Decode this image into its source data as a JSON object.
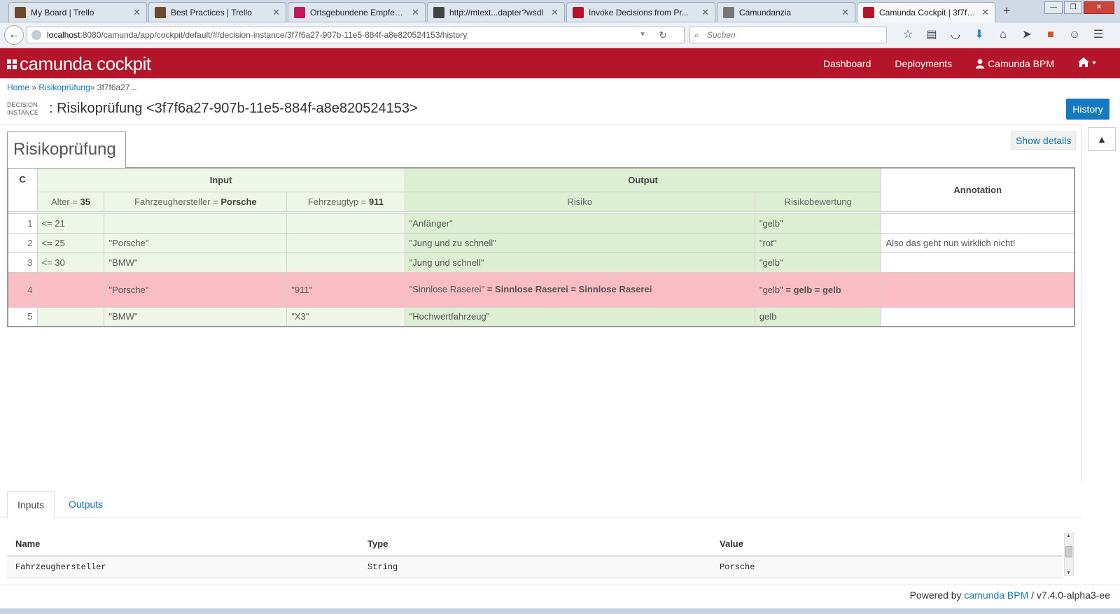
{
  "browser": {
    "tabs": [
      {
        "title": "My Board | Trello",
        "color": "#6b4a2e"
      },
      {
        "title": "Best Practices | Trello",
        "color": "#6b4a2e"
      },
      {
        "title": "Ortsgebundene Empfehl...",
        "color": "#c2185b"
      },
      {
        "title": "http://mtext...dapter?wsdl",
        "color": "#444444"
      },
      {
        "title": "Invoke Decisions from Pr...",
        "color": "#b5152b"
      },
      {
        "title": "Camundanzia",
        "color": "#777777"
      },
      {
        "title": "Camunda Cockpit | 3f7f6...",
        "color": "#b5152b"
      }
    ],
    "url_host": "localhost",
    "url_rest": ":8080/camunda/app/cockpit/default/#/decision-instance/3f7f6a27-907b-11e5-884f-a8e820524153/history",
    "search_placeholder": "Suchen"
  },
  "app": {
    "brand": "camunda cockpit",
    "menu": [
      "Dashboard",
      "Deployments"
    ],
    "user": "Camunda BPM"
  },
  "breadcrumb": {
    "home": "Home",
    "sep1": "»",
    "decision": "Risikoprüfung",
    "sep2": "»",
    "current": "3f7f6a27..."
  },
  "instance": {
    "label_line1": "DECISION",
    "label_line2": "INSTANCE",
    "title": ": Risikoprüfung <3f7f6a27-907b-11e5-884f-a8e820524153>",
    "history_button": "History"
  },
  "decision": {
    "name": "Risikoprüfung",
    "show_details": "Show details",
    "hit_policy": "C",
    "input_group": "Input",
    "output_group": "Output",
    "annotation_header": "Annotation",
    "inputs": [
      {
        "label": "Alter",
        "eq": " = ",
        "value": "35"
      },
      {
        "label": "Fahrzeughersteller",
        "eq": " = ",
        "value": "Porsche"
      },
      {
        "label": "Fehrzeugtyp",
        "eq": " = ",
        "value": "911"
      }
    ],
    "outputs": [
      "Risiko",
      "Risikobewertung"
    ],
    "rules": [
      {
        "n": "1",
        "c1": "<= 21",
        "c2": "",
        "c3": "",
        "o1": "\"Anfänger\"",
        "o1b": "",
        "o2": "\"gelb\"",
        "o2b": "",
        "annotation": ""
      },
      {
        "n": "2",
        "c1": "<= 25",
        "c2": "\"Porsche\"",
        "c3": "",
        "o1": "\"Jung und zu schnell\"",
        "o1b": "",
        "o2": "\"rot\"",
        "o2b": "",
        "annotation": "Also das geht nun wirklich nicht!"
      },
      {
        "n": "3",
        "c1": "<= 30",
        "c2": "\"BMW\"",
        "c3": "",
        "o1": "\"Jung und schnell\"",
        "o1b": "",
        "o2": "\"gelb\"",
        "o2b": "",
        "annotation": ""
      },
      {
        "n": "4",
        "c1": "",
        "c2": "\"Porsche\"",
        "c3": "\"911\"",
        "o1": "\"Sinnlose Raserei\"",
        "o1b": " = Sinnlose Raserei = Sinnlose Raserei",
        "o2": "\"gelb\"",
        "o2b": " = gelb = gelb",
        "annotation": ""
      },
      {
        "n": "5",
        "c1": "",
        "c2": "\"BMW\"",
        "c3": "\"X3\"",
        "o1": "\"Hochwertfahrzeug\"",
        "o1b": "",
        "o2": "gelb",
        "o2b": "",
        "annotation": ""
      }
    ]
  },
  "bottom": {
    "tabs": [
      "Inputs",
      "Outputs"
    ],
    "columns": [
      "Name",
      "Type",
      "Value"
    ],
    "rows": [
      {
        "name": "Fahrzeughersteller",
        "type": "String",
        "value": "Porsche"
      }
    ]
  },
  "footer": {
    "prefix": "Powered by ",
    "link": "camunda BPM",
    "version": " / v7.4.0-alpha3-ee"
  }
}
